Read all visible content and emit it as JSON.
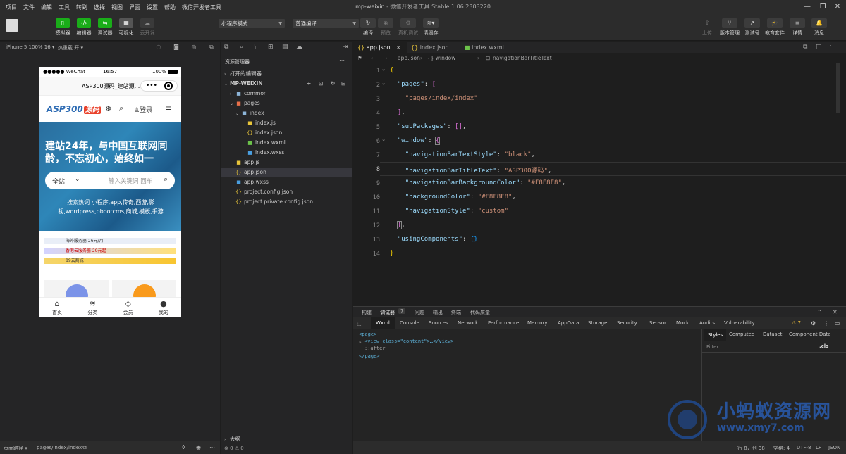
{
  "menu": [
    "项目",
    "文件",
    "编辑",
    "工具",
    "转到",
    "选择",
    "视图",
    "界面",
    "设置",
    "帮助",
    "微信开发者工具"
  ],
  "window": {
    "title": "mp-weixin",
    "subtitle": "- 微信开发者工具 Stable 1.06.2303220"
  },
  "toolbar": {
    "simulator": "模拟器",
    "editor": "编辑器",
    "debugger": "调试器",
    "visual": "可视化",
    "cloud": "云开发",
    "mode_select": "小程序模式",
    "compile_select": "普通编译",
    "compile": "编译",
    "preview": "预览",
    "remote_debug": "真机调试",
    "clear_cache": "清缓存",
    "upload": "上传",
    "version": "版本管理",
    "test": "测试号",
    "edu": "教育套件",
    "details": "详情",
    "messages": "消息"
  },
  "simulator": {
    "device": "iPhone 5 100% 16 ▾",
    "hotreload": "热重载 开 ▾",
    "status": {
      "carrier": "●●●●● WeChat",
      "time": "16:57",
      "battery": "100%"
    },
    "nav_title": "ASP300源码_建站源...",
    "logo_text": "ASP300",
    "logo_badge": "源码",
    "login": "登录",
    "hero_text": "建站24年，与中国互联网同龄，不忘初心，始终如一",
    "search_scope": "全站",
    "search_placeholder": "输入关键词 回车",
    "hot_text": "搜索热词 小程序,app,传奇,西游,影视,wordpress,pbootcms,商城,模板,手游",
    "ads": [
      "海外服务器 26元/月",
      "香港云服务器 29元起",
      "89云商城"
    ],
    "tabs": [
      "首页",
      "分类",
      "会员",
      "我的"
    ]
  },
  "explorer": {
    "title": "资源管理器",
    "open_editors": "打开的编辑器",
    "project": "MP-WEIXIN",
    "files": [
      {
        "name": "common",
        "type": "folder"
      },
      {
        "name": "pages",
        "type": "folder-open"
      },
      {
        "name": "index",
        "type": "folder-open"
      },
      {
        "name": "index.js",
        "type": "js"
      },
      {
        "name": "index.json",
        "type": "json"
      },
      {
        "name": "index.wxml",
        "type": "wxml"
      },
      {
        "name": "index.wxss",
        "type": "wxss"
      },
      {
        "name": "app.js",
        "type": "js"
      },
      {
        "name": "app.json",
        "type": "json"
      },
      {
        "name": "app.wxss",
        "type": "wxss"
      },
      {
        "name": "project.config.json",
        "type": "json"
      },
      {
        "name": "project.private.config.json",
        "type": "json"
      }
    ],
    "outline": "大纲",
    "problems": "⊗ 0 ⚠ 0"
  },
  "tabs": [
    "app.json",
    "index.json",
    "index.wxml"
  ],
  "breadcrumb": [
    "app.json",
    "{} window",
    "navigationBarTitleText"
  ],
  "code_lines": [
    "1",
    "2",
    "3",
    "4",
    "5",
    "6",
    "7",
    "8",
    "9",
    "10",
    "11",
    "12",
    "13",
    "14"
  ],
  "code": {
    "pages_key": "\"pages\"",
    "pages_val": "\"pages/index/index\"",
    "sub_key": "\"subPackages\"",
    "window_key": "\"window\"",
    "k1": "\"navigationBarTextStyle\"",
    "v1": "\"black\"",
    "k2": "\"navigationBarTitleText\"",
    "v2": "\"ASP300源码\"",
    "k3": "\"navigationBarBackgroundColor\"",
    "v3": "\"#F8F8F8\"",
    "k4": "\"backgroundColor\"",
    "v4": "\"#F8F8F8\"",
    "k5": "\"navigationStyle\"",
    "v5": "\"custom\"",
    "uc_key": "\"usingComponents\""
  },
  "devtools": {
    "top_tabs": [
      "构建",
      "调试器",
      "问题",
      "输出",
      "终端",
      "代码质量"
    ],
    "debugger_badge": "7",
    "tabs": [
      "Wxml",
      "Console",
      "Sources",
      "Network",
      "Performance",
      "Memory",
      "AppData",
      "Storage",
      "Security",
      "Sensor",
      "Mock",
      "Audits",
      "Vulnerability"
    ],
    "warn_count": "⚠ 7",
    "dom": [
      "<page>",
      "<view class=\"content\">…</view>",
      "::after",
      "</page>"
    ],
    "style_tabs": [
      "Styles",
      "Computed",
      "Dataset",
      "Component Data"
    ],
    "filter": "Filter",
    "cls": ".cls"
  },
  "simfooter": {
    "path_label": "页面路径 ▾",
    "path": "pages/index/index"
  },
  "statusbar": {
    "pos": "行 8，列 38",
    "spaces": "空格: 4",
    "enc": "UTF-8",
    "eol": "LF",
    "lang": "JSON"
  },
  "watermark": {
    "cn": "小蚂蚁资源网",
    "url": "www.xmy7.com"
  }
}
